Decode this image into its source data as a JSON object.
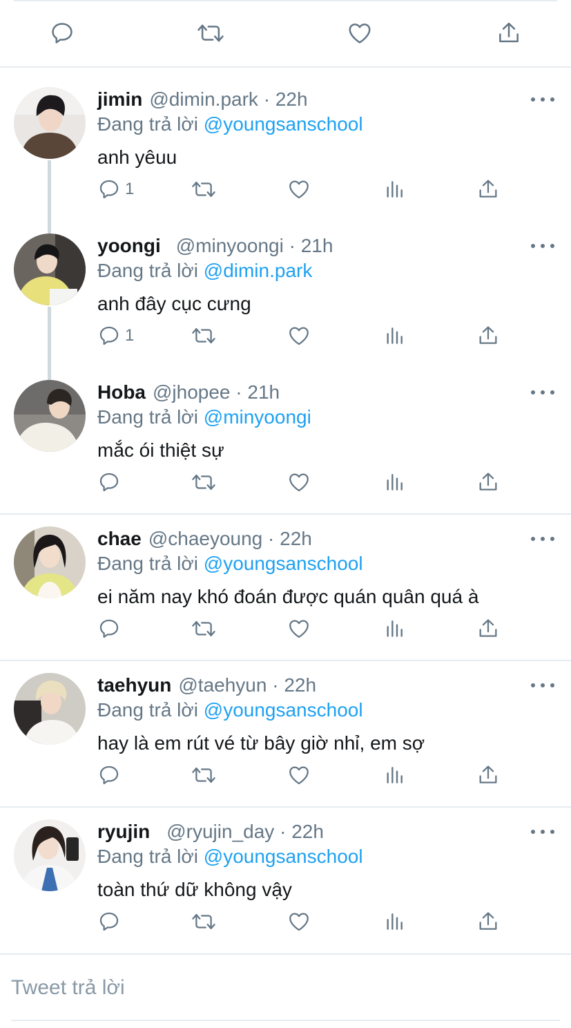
{
  "top_actions": [
    "reply-icon",
    "retweet-icon",
    "like-icon",
    "share-icon"
  ],
  "colors": {
    "accent": "#1da1f2",
    "secondary_text": "#657786",
    "primary_text": "#14171a",
    "divider": "#e6ecf0"
  },
  "replies": [
    {
      "name": "jimin",
      "handle": "@dimin.park",
      "time": "22h",
      "replying_prefix": "Đang trả lời",
      "replying_to": "@youngsanschool",
      "text": "anh yêuu",
      "reply_count": "1"
    },
    {
      "name": "yoongi",
      "handle": "@minyoongi",
      "time": "21h",
      "replying_prefix": "Đang trả lời",
      "replying_to": "@dimin.park",
      "text": "anh đây cục cưng",
      "reply_count": "1"
    },
    {
      "name": "Hoba",
      "handle": "@jhopee",
      "time": "21h",
      "replying_prefix": "Đang trả lời",
      "replying_to": "@minyoongi",
      "text": "mắc ói thiệt sự",
      "reply_count": ""
    },
    {
      "name": "chae",
      "handle": "@chaeyoung",
      "time": "22h",
      "replying_prefix": "Đang trả lời",
      "replying_to": "@youngsanschool",
      "text": "ei năm nay khó đoán được quán quân quá à",
      "reply_count": ""
    },
    {
      "name": "taehyun",
      "handle": "@taehyun",
      "time": "22h",
      "replying_prefix": "Đang trả lời",
      "replying_to": "@youngsanschool",
      "text": "hay là em rút vé từ bây giờ nhỉ, em sợ",
      "reply_count": ""
    },
    {
      "name": "ryujin",
      "handle": "@ryujin_day",
      "time": "22h",
      "replying_prefix": "Đang trả lời",
      "replying_to": "@youngsanschool",
      "text": "toàn thứ dữ không vậy",
      "reply_count": ""
    }
  ],
  "reply_box": {
    "placeholder": "Tweet trả lời"
  }
}
